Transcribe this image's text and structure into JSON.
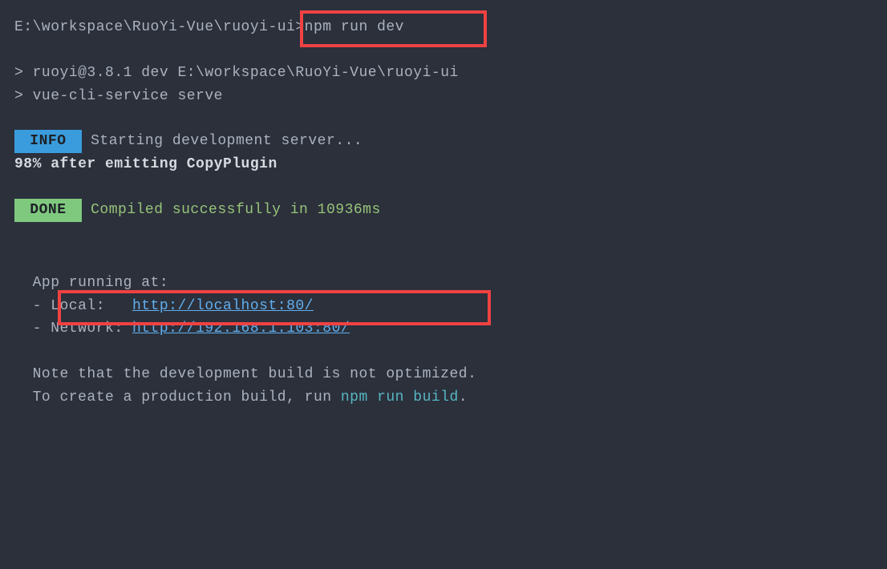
{
  "prompt": {
    "path": "E:\\workspace\\RuoYi-Vue\\ruoyi-ui>",
    "command": "npm run dev"
  },
  "output": {
    "pkg_line_prefix": "> ",
    "pkg_line": "ruoyi@3.8.1 dev E:\\workspace\\RuoYi-Vue\\ruoyi-ui",
    "serve_line_prefix": "> ",
    "serve_line": "vue-cli-service serve"
  },
  "info": {
    "badge": " INFO ",
    "text": " Starting development server..."
  },
  "progress": "98% after emitting CopyPlugin",
  "done": {
    "badge": " DONE ",
    "text": " Compiled successfully in 10936ms"
  },
  "app": {
    "running": "  App running at:",
    "local_label": "  - Local:   ",
    "local_url": "http://localhost:80/",
    "network_label": "  - Network: ",
    "network_url": "http://192.168.1.103:80/"
  },
  "note": {
    "line1": "  Note that the development build is not optimized.",
    "line2_prefix": "  To create a production build, run ",
    "npm_run": "npm run build",
    "period": "."
  }
}
